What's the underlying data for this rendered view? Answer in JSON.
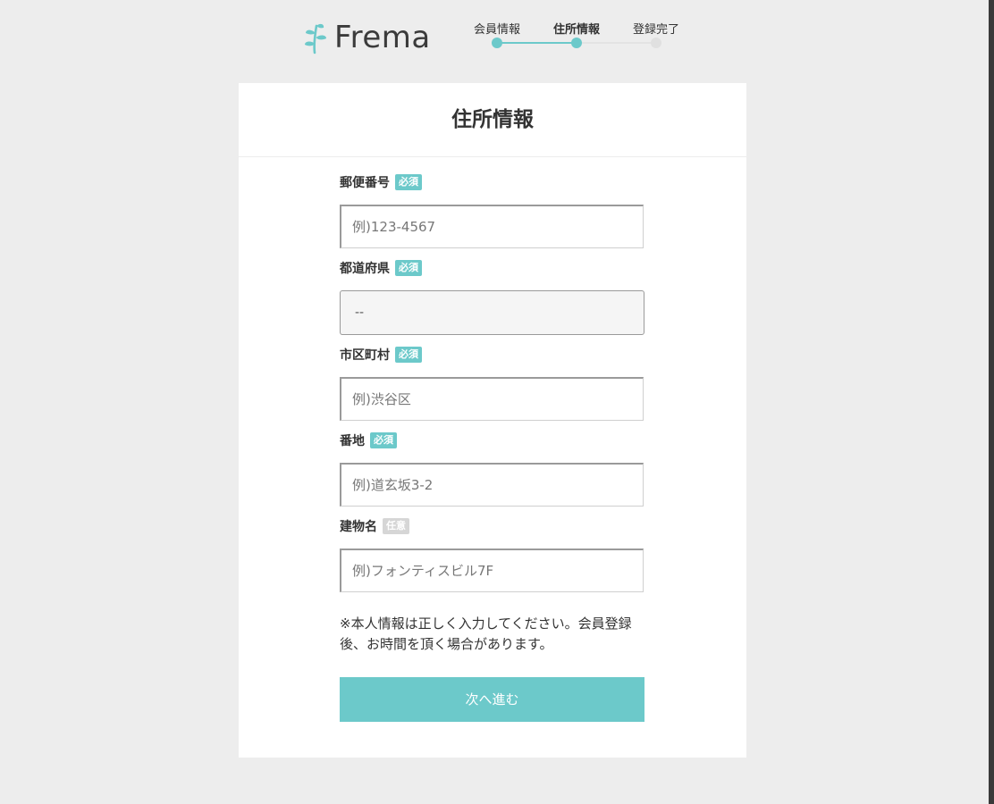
{
  "brand": {
    "name": "Frema",
    "accent_color": "#6cc9ca",
    "logo_icon": "leaf-sprout-icon"
  },
  "progress": {
    "steps": [
      {
        "label": "会員情報",
        "active": false
      },
      {
        "label": "住所情報",
        "active": true
      },
      {
        "label": "登録完了",
        "active": false
      }
    ],
    "current_step": 2,
    "completed_color": "#6cc9ca",
    "pending_color": "#e0e0e0"
  },
  "card": {
    "title": "住所情報"
  },
  "form": {
    "postal_code": {
      "label": "郵便番号",
      "badge": "必須",
      "placeholder": "例)123-4567",
      "value": ""
    },
    "prefecture": {
      "label": "都道府県",
      "badge": "必須",
      "selected": "--"
    },
    "city": {
      "label": "市区町村",
      "badge": "必須",
      "placeholder": "例)渋谷区",
      "value": ""
    },
    "street": {
      "label": "番地",
      "badge": "必須",
      "placeholder": "例)道玄坂3-2",
      "value": ""
    },
    "building": {
      "label": "建物名",
      "badge": "任意",
      "placeholder": "例)フォンティスビル7F",
      "value": ""
    },
    "note": "※本人情報は正しく入力してください。会員登録後、お時間を頂く場合があります。",
    "submit_label": "次へ進む"
  },
  "colors": {
    "required_badge": "#6cc9ca",
    "optional_badge": "#d6d6d6",
    "page_background": "#ededed"
  }
}
